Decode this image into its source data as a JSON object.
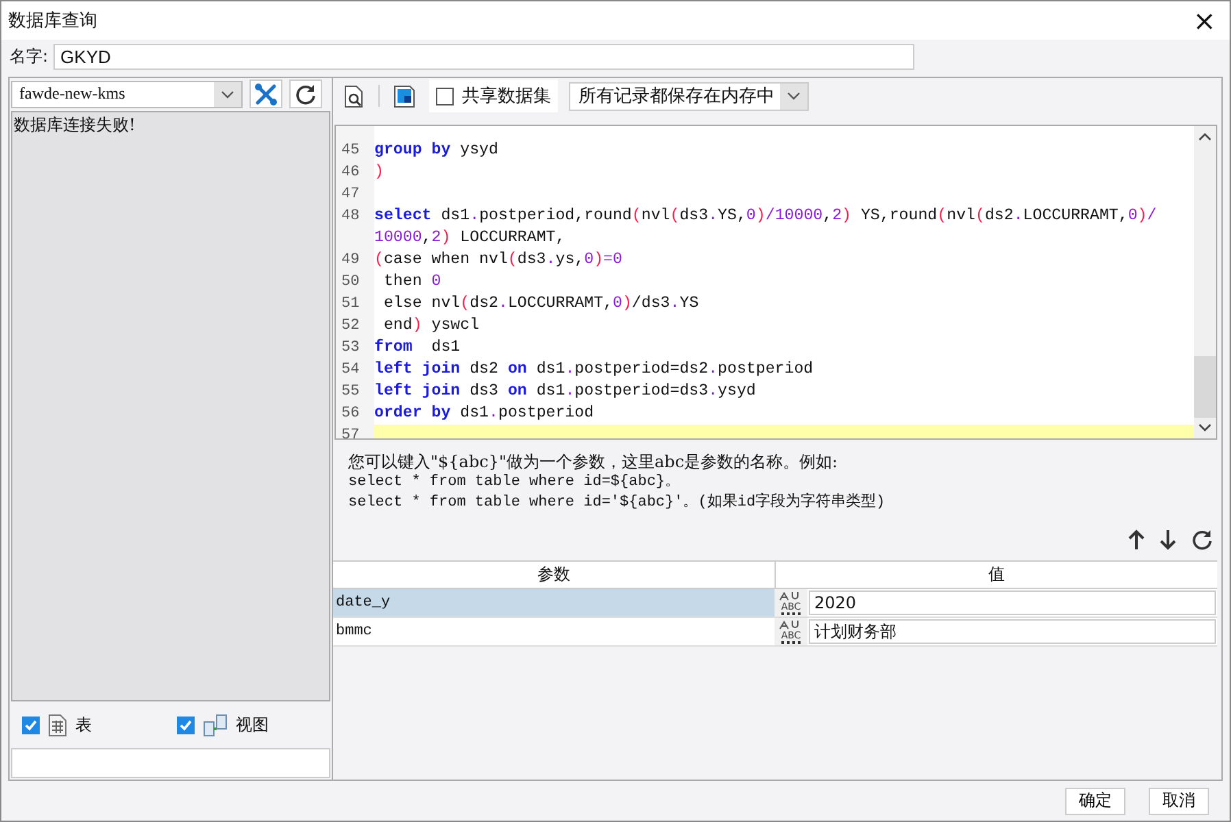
{
  "window": {
    "title": "数据库查询",
    "close": "×"
  },
  "name_field": {
    "label": "名字:",
    "value": "GKYD"
  },
  "connection": {
    "value": "fawde-new-kms",
    "message": "数据库连接失败!"
  },
  "filters": [
    {
      "label": "表",
      "kind": "table",
      "checked": true
    },
    {
      "label": "视图",
      "kind": "view",
      "checked": true
    }
  ],
  "toolbar": {
    "share": {
      "label": "共享数据集",
      "checked": false
    },
    "storage": "所有记录都保存在内存中"
  },
  "code_lines": [
    {
      "num": "45",
      "current": false,
      "tokens": [
        {
          "kind": "kw",
          "text": "group"
        },
        {
          "kind": "kw",
          "text": " by"
        },
        {
          "kind": "text",
          "text": " ysyd"
        }
      ]
    },
    {
      "num": "46",
      "current": false,
      "tokens": [
        {
          "kind": "paren",
          "text": ")"
        }
      ]
    },
    {
      "num": "47",
      "current": false
    },
    {
      "num": "48",
      "current": false,
      "tokens": [
        {
          "kind": "kw",
          "text": "select"
        },
        {
          "kind": "text",
          "text": " ds1"
        },
        {
          "kind": "num",
          "text": "."
        },
        {
          "kind": "text",
          "text": "postperiod,round"
        },
        {
          "kind": "paren",
          "text": "("
        },
        {
          "kind": "text",
          "text": "nvl"
        },
        {
          "kind": "paren",
          "text": "("
        },
        {
          "kind": "text",
          "text": "ds3"
        },
        {
          "kind": "num",
          "text": "."
        },
        {
          "kind": "text",
          "text": "YS,"
        },
        {
          "kind": "num",
          "text": "0"
        },
        {
          "kind": "paren",
          "text": ")"
        },
        {
          "kind": "num",
          "text": "/10000"
        },
        {
          "kind": "text",
          "text": ","
        },
        {
          "kind": "num",
          "text": "2"
        },
        {
          "kind": "paren",
          "text": ")"
        },
        {
          "kind": "text",
          "text": " YS,round"
        },
        {
          "kind": "paren",
          "text": "("
        },
        {
          "kind": "text",
          "text": "nvl"
        },
        {
          "kind": "paren",
          "text": "("
        },
        {
          "kind": "text",
          "text": "ds2"
        },
        {
          "kind": "num",
          "text": "."
        },
        {
          "kind": "text",
          "text": "LOCCURRAMT,"
        },
        {
          "kind": "num",
          "text": "0"
        },
        {
          "kind": "paren",
          "text": ")"
        },
        {
          "kind": "num",
          "text": "/10000"
        },
        {
          "kind": "text",
          "text": ","
        },
        {
          "kind": "num",
          "text": "2"
        },
        {
          "kind": "paren",
          "text": ")"
        },
        {
          "kind": "text",
          "text": " LOCCURRAMT,"
        }
      ]
    },
    {
      "num": "49",
      "current": false,
      "tokens": [
        {
          "kind": "paren",
          "text": "("
        },
        {
          "kind": "text",
          "text": "case when nvl"
        },
        {
          "kind": "paren",
          "text": "("
        },
        {
          "kind": "text",
          "text": "ds3"
        },
        {
          "kind": "num",
          "text": "."
        },
        {
          "kind": "text",
          "text": "ys,"
        },
        {
          "kind": "num",
          "text": "0"
        },
        {
          "kind": "paren",
          "text": ")"
        },
        {
          "kind": "num",
          "text": "=0"
        }
      ]
    },
    {
      "num": "50",
      "current": false,
      "tokens": [
        {
          "kind": "text",
          "text": " then "
        },
        {
          "kind": "num",
          "text": "0"
        }
      ]
    },
    {
      "num": "51",
      "current": false,
      "tokens": [
        {
          "kind": "text",
          "text": " else nvl"
        },
        {
          "kind": "paren",
          "text": "("
        },
        {
          "kind": "text",
          "text": "ds2"
        },
        {
          "kind": "num",
          "text": "."
        },
        {
          "kind": "text",
          "text": "LOCCURRAMT,"
        },
        {
          "kind": "num",
          "text": "0"
        },
        {
          "kind": "paren",
          "text": ")"
        },
        {
          "kind": "text",
          "text": "/ds3"
        },
        {
          "kind": "num",
          "text": "."
        },
        {
          "kind": "text",
          "text": "YS"
        }
      ]
    },
    {
      "num": "52",
      "current": false,
      "tokens": [
        {
          "kind": "text",
          "text": " end"
        },
        {
          "kind": "paren",
          "text": ")"
        },
        {
          "kind": "text",
          "text": " yswcl"
        }
      ]
    },
    {
      "num": "53",
      "current": false,
      "tokens": [
        {
          "kind": "kw",
          "text": "from"
        },
        {
          "kind": "text",
          "text": "  ds1"
        }
      ]
    },
    {
      "num": "54",
      "current": false,
      "tokens": [
        {
          "kind": "kw",
          "text": "left"
        },
        {
          "kind": "kw",
          "text": " join"
        },
        {
          "kind": "text",
          "text": " ds2 "
        },
        {
          "kind": "kw",
          "text": "on"
        },
        {
          "kind": "text",
          "text": " ds1"
        },
        {
          "kind": "num",
          "text": "."
        },
        {
          "kind": "text",
          "text": "postperiod=ds2"
        },
        {
          "kind": "num",
          "text": "."
        },
        {
          "kind": "text",
          "text": "postperiod"
        }
      ]
    },
    {
      "num": "55",
      "current": false,
      "tokens": [
        {
          "kind": "kw",
          "text": "left"
        },
        {
          "kind": "kw",
          "text": " join"
        },
        {
          "kind": "text",
          "text": " ds3 "
        },
        {
          "kind": "kw",
          "text": "on"
        },
        {
          "kind": "text",
          "text": " ds1"
        },
        {
          "kind": "num",
          "text": "."
        },
        {
          "kind": "text",
          "text": "postperiod=ds3"
        },
        {
          "kind": "num",
          "text": "."
        },
        {
          "kind": "text",
          "text": "ysyd"
        }
      ]
    },
    {
      "num": "56",
      "current": false,
      "tokens": [
        {
          "kind": "kw",
          "text": "order"
        },
        {
          "kind": "kw",
          "text": " by"
        },
        {
          "kind": "text",
          "text": " ds1"
        },
        {
          "kind": "num",
          "text": "."
        },
        {
          "kind": "text",
          "text": "postperiod"
        }
      ]
    },
    {
      "num": "57",
      "current": true
    }
  ],
  "help_lines": [
    "您可以键入\"${abc}\"做为一个参数，这里abc是参数的名称。例如:",
    "select * from table where id=${abc}。",
    "select * from table where id='${abc}'。(如果id字段为字符串类型)"
  ],
  "params": {
    "columns": [
      "参数",
      "值"
    ],
    "rows": [
      {
        "name": "date_y",
        "type": "ABC",
        "value": "2020",
        "selected": true
      },
      {
        "name": "bmmc",
        "type": "ABC",
        "value": "计划财务部",
        "selected": false
      }
    ]
  },
  "buttons": [
    "确定",
    "取消"
  ]
}
